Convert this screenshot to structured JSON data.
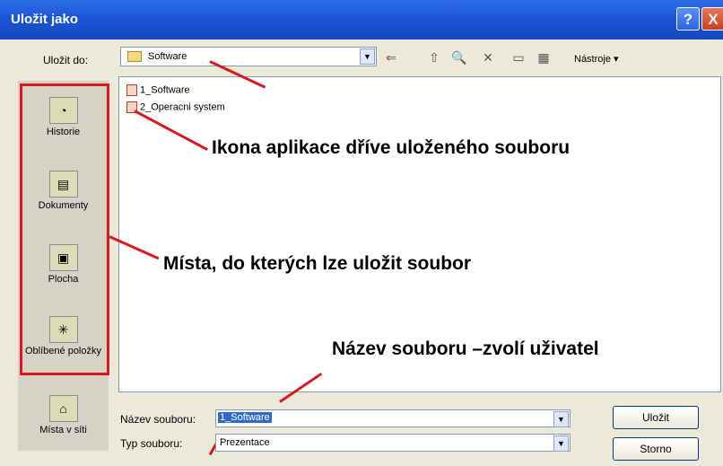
{
  "window": {
    "title": "Uložit jako",
    "help_label": "?",
    "close_label": "X"
  },
  "toolbar": {
    "save_in_label": "Uložit do:",
    "save_in_value": "Software",
    "tools_label": "Nástroje ▾",
    "icons": [
      "back-icon",
      "up-folder-icon",
      "search-web-icon",
      "delete-icon",
      "new-folder-icon",
      "views-icon"
    ]
  },
  "places": [
    {
      "label": "Historie",
      "icon": "history-icon"
    },
    {
      "label": "Dokumenty",
      "icon": "documents-icon"
    },
    {
      "label": "Plocha",
      "icon": "desktop-icon"
    },
    {
      "label": "Oblíbené položky",
      "icon": "favorites-icon"
    },
    {
      "label": "Místa v síti",
      "icon": "network-icon"
    }
  ],
  "files": [
    "1_Software",
    "2_Operacni system"
  ],
  "annotations": {
    "icon_note": "Ikona aplikace dříve uloženého souboru",
    "places_note": "Místa, do kterých lze uložit soubor",
    "filename_note": "Název souboru –zvolí uživatel"
  },
  "form": {
    "filename_label": "Název souboru:",
    "filename_value": "1_Software",
    "filetype_label": "Typ souboru:",
    "filetype_value": "Prezentace"
  },
  "buttons": {
    "save": "Uložit",
    "cancel": "Storno"
  },
  "colors": {
    "titlebar": "#1b55d6",
    "annotation_red": "#d71920",
    "selection": "#316ac5"
  }
}
